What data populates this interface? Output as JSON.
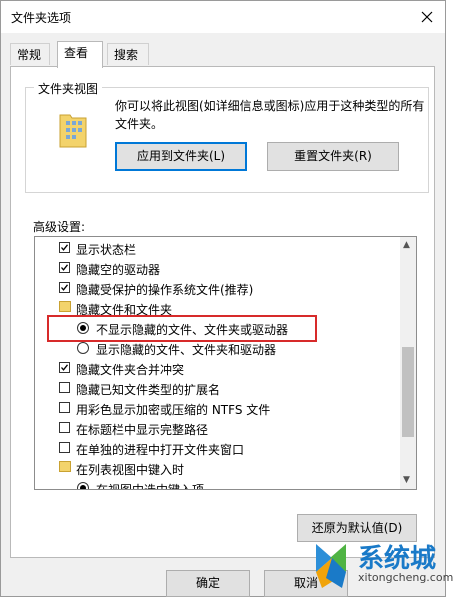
{
  "window": {
    "title": "文件夹选项"
  },
  "tabs": [
    {
      "label": "常规"
    },
    {
      "label": "查看"
    },
    {
      "label": "搜索"
    }
  ],
  "folder_views": {
    "legend": "文件夹视图",
    "description": "你可以将此视图(如详细信息或图标)应用于这种类型的所有文件夹。",
    "apply_button": "应用到文件夹(L)",
    "reset_button": "重置文件夹(R)"
  },
  "advanced": {
    "label": "高级设置:",
    "items": [
      {
        "type": "checkbox",
        "checked": true,
        "label": "显示状态栏"
      },
      {
        "type": "checkbox",
        "checked": true,
        "label": "隐藏空的驱动器"
      },
      {
        "type": "checkbox",
        "checked": true,
        "label": "隐藏受保护的操作系统文件(推荐)"
      },
      {
        "type": "folder",
        "label": "隐藏文件和文件夹"
      },
      {
        "type": "radio",
        "checked": true,
        "label": "不显示隐藏的文件、文件夹或驱动器"
      },
      {
        "type": "radio",
        "checked": false,
        "label": "显示隐藏的文件、文件夹和驱动器"
      },
      {
        "type": "checkbox",
        "checked": true,
        "label": "隐藏文件夹合并冲突"
      },
      {
        "type": "checkbox",
        "checked": false,
        "label": "隐藏已知文件类型的扩展名"
      },
      {
        "type": "checkbox",
        "checked": false,
        "label": "用彩色显示加密或压缩的 NTFS 文件"
      },
      {
        "type": "checkbox",
        "checked": false,
        "label": "在标题栏中显示完整路径"
      },
      {
        "type": "checkbox",
        "checked": false,
        "label": "在单独的进程中打开文件夹窗口"
      },
      {
        "type": "folder",
        "label": "在列表视图中键入时"
      },
      {
        "type": "radio",
        "checked": true,
        "label": "在视图中选中键入项"
      }
    ],
    "restore_button": "还原为默认值(D)"
  },
  "footer": {
    "ok_button": "确定",
    "cancel_button": "取消"
  },
  "watermark": {
    "brand": "系统城",
    "url": "xitongcheng.com"
  },
  "colors": {
    "highlight": "#d72a2a",
    "accent": "#0078d7"
  }
}
